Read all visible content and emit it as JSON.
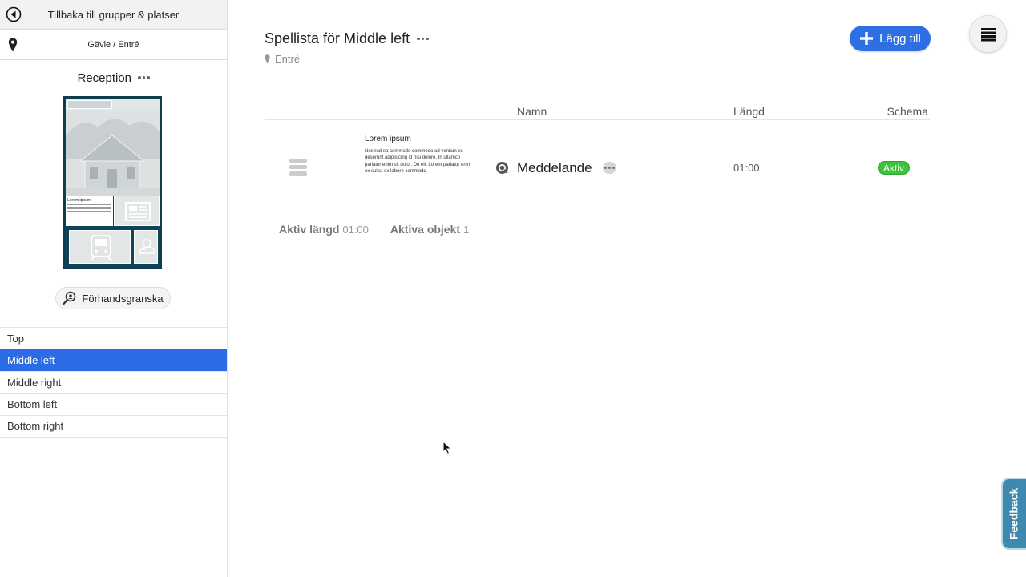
{
  "sidebar": {
    "back_label": "Tillbaka till grupper & platser",
    "location_label": "Gävle / Entré",
    "screen_title": "Reception",
    "preview_thumb_text": "Lorem ipsum",
    "preview_button_label": "Förhandsgranska",
    "zones": [
      {
        "label": "Top",
        "active": false
      },
      {
        "label": "Middle left",
        "active": true
      },
      {
        "label": "Middle right",
        "active": false
      },
      {
        "label": "Bottom left",
        "active": false
      },
      {
        "label": "Bottom right",
        "active": false
      }
    ]
  },
  "main": {
    "title": "Spellista för Middle left",
    "subtitle": "Entré",
    "add_button_label": "Lägg till",
    "table": {
      "headers": {
        "name": "Namn",
        "length": "Längd",
        "schema": "Schema"
      },
      "rows": [
        {
          "thumb_title": "Lorem ipsum",
          "thumb_body": "Nostrud ea commodo commodo ad veniam eu deserunt adipisicing id nisi dolore. In ullamco pariatur enim sit dolor. Do elit Lorem pariatur enim ex culpa ex labore commodo",
          "name": "Meddelande",
          "length": "01:00",
          "status": "Aktiv"
        }
      ]
    },
    "summary": {
      "active_length_label": "Aktiv längd",
      "active_length_value": "01:00",
      "active_objects_label": "Aktiva objekt",
      "active_objects_value": "1"
    }
  },
  "feedback_label": "Feedback",
  "colors": {
    "accent": "#2b6be5",
    "status_active": "#3bc33b",
    "feedback_tab": "#3e89b0"
  }
}
